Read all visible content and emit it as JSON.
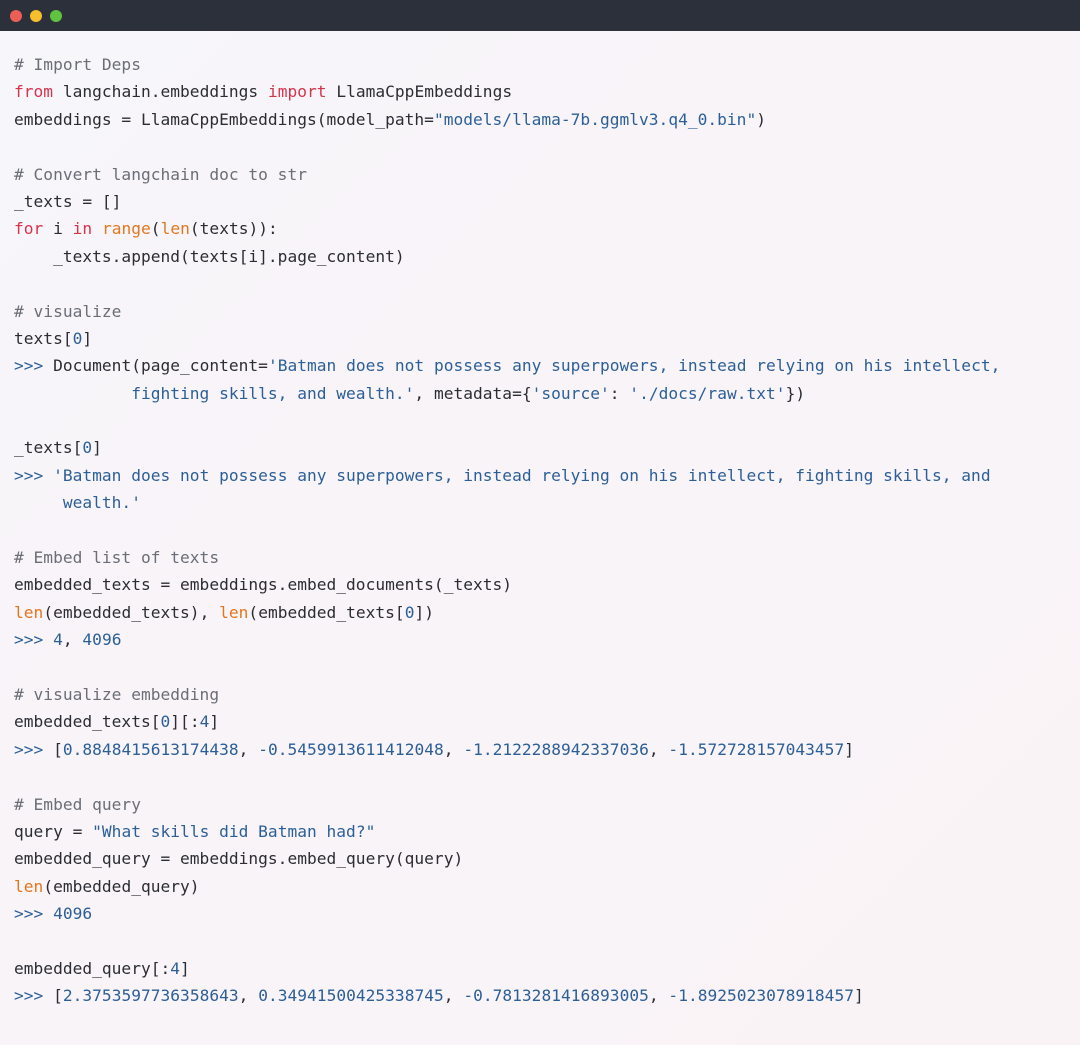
{
  "window": {
    "buttons": {
      "close_color": "#ed5f56",
      "minimize_color": "#f6bd2e",
      "maximize_color": "#5fc33f"
    }
  },
  "colors": {
    "titlebar": "#2b303b",
    "comment": "#6b6e76",
    "keyword": "#d7334b",
    "builtin": "#e2771f",
    "string_number": "#2c5f97",
    "text": "#2b2d33"
  },
  "code": {
    "lines": [
      [
        [
          "cm",
          "# Import Deps"
        ]
      ],
      [
        [
          "kw",
          "from"
        ],
        [
          "tx",
          " langchain.embeddings "
        ],
        [
          "kw",
          "import"
        ],
        [
          "tx",
          " LlamaCppEmbeddings"
        ]
      ],
      [
        [
          "tx",
          "embeddings = LlamaCppEmbeddings(model_path="
        ],
        [
          "st",
          "\"models/llama-7b.ggmlv3.q4_0.bin\""
        ],
        [
          "tx",
          ")"
        ]
      ],
      [],
      [
        [
          "cm",
          "# Convert langchain doc to str"
        ]
      ],
      [
        [
          "tx",
          "_texts = []"
        ]
      ],
      [
        [
          "kw",
          "for"
        ],
        [
          "tx",
          " i "
        ],
        [
          "kw",
          "in"
        ],
        [
          "tx",
          " "
        ],
        [
          "bi",
          "range"
        ],
        [
          "tx",
          "("
        ],
        [
          "bi",
          "len"
        ],
        [
          "tx",
          "(texts)):"
        ]
      ],
      [
        [
          "tx",
          "    _texts.append(texts[i].page_content)"
        ]
      ],
      [],
      [
        [
          "cm",
          "# visualize"
        ]
      ],
      [
        [
          "tx",
          "texts["
        ],
        [
          "nm",
          "0"
        ],
        [
          "tx",
          "]"
        ]
      ],
      [
        [
          "pr",
          ">>> "
        ],
        [
          "tx",
          "Document(page_content="
        ],
        [
          "st",
          "'Batman does not possess any superpowers, instead relying on his intellect,"
        ]
      ],
      [
        [
          "st",
          "            fighting skills, and wealth.'"
        ],
        [
          "tx",
          ", metadata={"
        ],
        [
          "st",
          "'source'"
        ],
        [
          "tx",
          ": "
        ],
        [
          "st",
          "'./docs/raw.txt'"
        ],
        [
          "tx",
          "})"
        ]
      ],
      [],
      [
        [
          "tx",
          "_texts["
        ],
        [
          "nm",
          "0"
        ],
        [
          "tx",
          "]"
        ]
      ],
      [
        [
          "pr",
          ">>> "
        ],
        [
          "st",
          "'Batman does not possess any superpowers, instead relying on his intellect, fighting skills, and"
        ]
      ],
      [
        [
          "st",
          "     wealth.'"
        ]
      ],
      [],
      [
        [
          "cm",
          "# Embed list of texts"
        ]
      ],
      [
        [
          "tx",
          "embedded_texts = embeddings.embed_documents(_texts)"
        ]
      ],
      [
        [
          "bi",
          "len"
        ],
        [
          "tx",
          "(embedded_texts), "
        ],
        [
          "bi",
          "len"
        ],
        [
          "tx",
          "(embedded_texts["
        ],
        [
          "nm",
          "0"
        ],
        [
          "tx",
          "])"
        ]
      ],
      [
        [
          "pr",
          ">>> "
        ],
        [
          "nm",
          "4"
        ],
        [
          "tx",
          ", "
        ],
        [
          "nm",
          "4096"
        ]
      ],
      [],
      [
        [
          "cm",
          "# visualize embedding"
        ]
      ],
      [
        [
          "tx",
          "embedded_texts["
        ],
        [
          "nm",
          "0"
        ],
        [
          "tx",
          "][:"
        ],
        [
          "nm",
          "4"
        ],
        [
          "tx",
          "]"
        ]
      ],
      [
        [
          "pr",
          ">>> "
        ],
        [
          "tx",
          "["
        ],
        [
          "nm",
          "0.8848415613174438"
        ],
        [
          "tx",
          ", "
        ],
        [
          "nm",
          "-0.5459913611412048"
        ],
        [
          "tx",
          ", "
        ],
        [
          "nm",
          "-1.2122288942337036"
        ],
        [
          "tx",
          ", "
        ],
        [
          "nm",
          "-1.572728157043457"
        ],
        [
          "tx",
          "]"
        ]
      ],
      [],
      [
        [
          "cm",
          "# Embed query"
        ]
      ],
      [
        [
          "tx",
          "query = "
        ],
        [
          "st",
          "\"What skills did Batman had?\""
        ]
      ],
      [
        [
          "tx",
          "embedded_query = embeddings.embed_query(query)"
        ]
      ],
      [
        [
          "bi",
          "len"
        ],
        [
          "tx",
          "(embedded_query)"
        ]
      ],
      [
        [
          "pr",
          ">>> "
        ],
        [
          "nm",
          "4096"
        ]
      ],
      [],
      [
        [
          "tx",
          "embedded_query[:"
        ],
        [
          "nm",
          "4"
        ],
        [
          "tx",
          "]"
        ]
      ],
      [
        [
          "pr",
          ">>> "
        ],
        [
          "tx",
          "["
        ],
        [
          "nm",
          "2.3753597736358643"
        ],
        [
          "tx",
          ", "
        ],
        [
          "nm",
          "0.34941500425338745"
        ],
        [
          "tx",
          ", "
        ],
        [
          "nm",
          "-0.7813281416893005"
        ],
        [
          "tx",
          ", "
        ],
        [
          "nm",
          "-1.8925023078918457"
        ],
        [
          "tx",
          "]"
        ]
      ]
    ]
  }
}
